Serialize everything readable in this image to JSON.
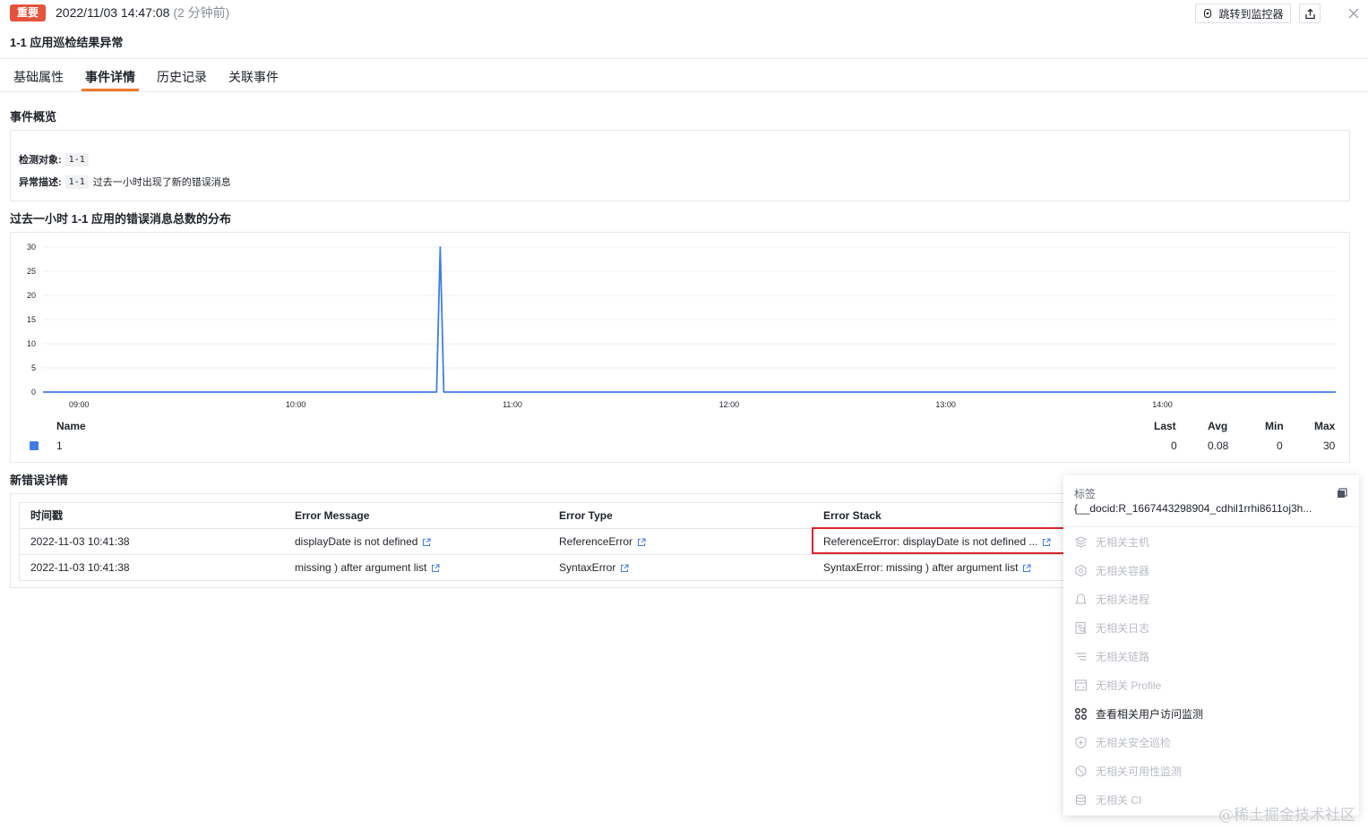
{
  "header": {
    "level_badge": "重要",
    "timestamp": "2022/11/03 14:47:08",
    "relative_time": "(2 分钟前)",
    "title": "1-1 应用巡检结果异常",
    "jump_button": "跳转到监控器",
    "icons": [
      "monitor-icon",
      "share-icon",
      "close-icon"
    ]
  },
  "tabs": [
    {
      "label": "基础属性"
    },
    {
      "label": "事件详情"
    },
    {
      "label": "历史记录"
    },
    {
      "label": "关联事件"
    }
  ],
  "active_tab": "事件详情",
  "overview": {
    "title": "事件概览",
    "target_label": "检测对象:",
    "target_value": "1-1",
    "desc_label": "异常描述:",
    "desc_tag": "1-1",
    "desc_text": "过去一小时出现了新的错误消息"
  },
  "chart_section": {
    "title": "过去一小时 1-1 应用的错误消息总数的分布"
  },
  "chart_data": {
    "type": "line",
    "title": "",
    "xlabel": "",
    "ylabel": "",
    "x_ticks": [
      "09:00",
      "10:00",
      "11:00",
      "12:00",
      "13:00",
      "14:00"
    ],
    "y_ticks": [
      0,
      5,
      10,
      15,
      20,
      25,
      30
    ],
    "ylim": [
      0,
      30
    ],
    "xlim": [
      "08:50",
      "14:48"
    ],
    "grid": true,
    "series": [
      {
        "name": "1",
        "color": "#3f7ee8",
        "points": [
          [
            "08:50",
            0
          ],
          [
            "10:39",
            0
          ],
          [
            "10:40",
            30
          ],
          [
            "10:41",
            0
          ],
          [
            "14:48",
            0
          ]
        ]
      }
    ],
    "legend": {
      "position": "bottom",
      "headers": [
        "Name",
        "Last",
        "Avg",
        "Min",
        "Max"
      ],
      "rows": [
        {
          "name": "1",
          "last": "0",
          "avg": "0.08",
          "min": "0",
          "max": "30"
        }
      ]
    }
  },
  "errors": {
    "title": "新错误详情",
    "columns": [
      "时间戳",
      "Error Message",
      "Error Type",
      "Error Stack"
    ],
    "rows": [
      {
        "time": "2022-11-03 10:41:38",
        "message": "displayDate is not defined",
        "type": "ReferenceError",
        "stack": "ReferenceError: displayDate is not defined ..."
      },
      {
        "time": "2022-11-03 10:41:38",
        "message": "missing ) after argument list",
        "type": "SyntaxError",
        "stack": "SyntaxError: missing ) after argument list"
      }
    ]
  },
  "side_panel": {
    "tag_label": "标签",
    "tag_value": "{__docid:R_1667443298904_cdhil1rrhi8611oj3h...",
    "items": [
      {
        "label": "无相关主机",
        "icon": "host-icon",
        "enabled": false
      },
      {
        "label": "无相关容器",
        "icon": "container-icon",
        "enabled": false
      },
      {
        "label": "无相关进程",
        "icon": "process-icon",
        "enabled": false
      },
      {
        "label": "无相关日志",
        "icon": "log-icon",
        "enabled": false
      },
      {
        "label": "无相关链路",
        "icon": "trace-icon",
        "enabled": false
      },
      {
        "label": "无相关 Profile",
        "icon": "profile-icon",
        "enabled": false
      },
      {
        "label": "查看相关用户访问监测",
        "icon": "rum-icon",
        "enabled": true
      },
      {
        "label": "无相关安全巡检",
        "icon": "security-icon",
        "enabled": false
      },
      {
        "label": "无相关可用性监测",
        "icon": "availability-icon",
        "enabled": false
      },
      {
        "label": "无相关 CI",
        "icon": "ci-icon",
        "enabled": false
      }
    ]
  },
  "watermark": "@稀土掘金技术社区"
}
